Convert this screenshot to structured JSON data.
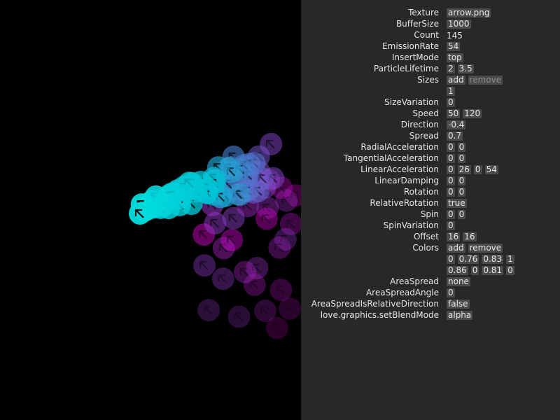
{
  "viewport": {
    "emitter_colors": [
      "#00dcdc",
      "#00c2d4",
      "#dc00cf",
      "#8a40c8"
    ],
    "glyph": "arrow-icon"
  },
  "panel": {
    "rows": [
      {
        "label": "Texture",
        "values": [
          {
            "text": "arrow.png",
            "kind": "input"
          }
        ]
      },
      {
        "label": "BufferSize",
        "values": [
          {
            "text": "1000",
            "kind": "input"
          }
        ]
      },
      {
        "label": "Count",
        "values": [
          {
            "text": "145",
            "kind": "plain"
          }
        ]
      },
      {
        "label": "EmissionRate",
        "values": [
          {
            "text": "54",
            "kind": "input"
          }
        ]
      },
      {
        "label": "InsertMode",
        "values": [
          {
            "text": "top",
            "kind": "input"
          }
        ]
      },
      {
        "label": "ParticleLifetime",
        "values": [
          {
            "text": "2",
            "kind": "input"
          },
          {
            "text": "3.5",
            "kind": "input"
          }
        ]
      },
      {
        "label": "Sizes",
        "values": [
          {
            "text": "add",
            "kind": "button"
          },
          {
            "text": "remove",
            "kind": "button-dim"
          }
        ]
      },
      {
        "label": "",
        "values": [
          {
            "text": "1",
            "kind": "input"
          }
        ]
      },
      {
        "label": "SizeVariation",
        "values": [
          {
            "text": "0",
            "kind": "input"
          }
        ]
      },
      {
        "label": "Speed",
        "values": [
          {
            "text": "50",
            "kind": "input"
          },
          {
            "text": "120",
            "kind": "input"
          }
        ]
      },
      {
        "label": "Direction",
        "values": [
          {
            "text": "-0.4",
            "kind": "input"
          }
        ]
      },
      {
        "label": "Spread",
        "values": [
          {
            "text": "0.7",
            "kind": "input"
          }
        ]
      },
      {
        "label": "RadialAcceleration",
        "values": [
          {
            "text": "0",
            "kind": "input"
          },
          {
            "text": "0",
            "kind": "input"
          }
        ]
      },
      {
        "label": "TangentialAcceleration",
        "values": [
          {
            "text": "0",
            "kind": "input"
          },
          {
            "text": "0",
            "kind": "input"
          }
        ]
      },
      {
        "label": "LinearAcceleration",
        "values": [
          {
            "text": "0",
            "kind": "input"
          },
          {
            "text": "26",
            "kind": "input"
          },
          {
            "text": "0",
            "kind": "input"
          },
          {
            "text": "54",
            "kind": "input"
          }
        ]
      },
      {
        "label": "LinearDamping",
        "values": [
          {
            "text": "0",
            "kind": "input"
          },
          {
            "text": "0",
            "kind": "input"
          }
        ]
      },
      {
        "label": "Rotation",
        "values": [
          {
            "text": "0",
            "kind": "input"
          },
          {
            "text": "0",
            "kind": "input"
          }
        ]
      },
      {
        "label": "RelativeRotation",
        "values": [
          {
            "text": "true",
            "kind": "input"
          }
        ]
      },
      {
        "label": "Spin",
        "values": [
          {
            "text": "0",
            "kind": "input"
          },
          {
            "text": "0",
            "kind": "input"
          }
        ]
      },
      {
        "label": "SpinVariation",
        "values": [
          {
            "text": "0",
            "kind": "input"
          }
        ]
      },
      {
        "label": "Offset",
        "values": [
          {
            "text": "16",
            "kind": "input"
          },
          {
            "text": "16",
            "kind": "input"
          }
        ]
      },
      {
        "label": "Colors",
        "values": [
          {
            "text": "add",
            "kind": "button"
          },
          {
            "text": "remove",
            "kind": "button"
          }
        ]
      },
      {
        "label": "",
        "values": [
          {
            "text": "0",
            "kind": "input"
          },
          {
            "text": "0.76",
            "kind": "input"
          },
          {
            "text": "0.83",
            "kind": "input"
          },
          {
            "text": "1",
            "kind": "input"
          }
        ]
      },
      {
        "label": "",
        "values": [
          {
            "text": "0.86",
            "kind": "input"
          },
          {
            "text": "0",
            "kind": "input"
          },
          {
            "text": "0.81",
            "kind": "input"
          },
          {
            "text": "0",
            "kind": "input"
          }
        ]
      },
      {
        "label": "AreaSpread",
        "values": [
          {
            "text": "none",
            "kind": "input"
          }
        ]
      },
      {
        "label": "AreaSpreadAngle",
        "values": [
          {
            "text": "0",
            "kind": "input"
          }
        ]
      },
      {
        "label": "AreaSpreadIsRelativeDirection",
        "values": [
          {
            "text": "false",
            "kind": "input"
          }
        ]
      },
      {
        "label": "love.graphics.setBlendMode",
        "values": [
          {
            "text": "alpha",
            "kind": "input"
          }
        ]
      }
    ]
  }
}
